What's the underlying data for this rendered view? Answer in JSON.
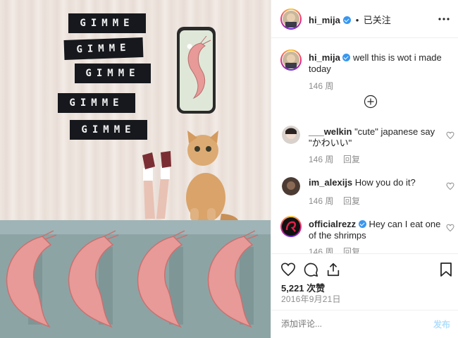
{
  "post": {
    "image_labels": [
      "GIMME",
      "GIMME",
      "GIMME",
      "GIMME",
      "GIMME"
    ],
    "image_alt_icon": "shrimp-collage-image"
  },
  "header": {
    "username": "hi_mija",
    "separator": "•",
    "follow_status": "已关注",
    "more_icon": "ellipsis-icon"
  },
  "caption": {
    "username": "hi_mija",
    "text": "well this is wot i made today",
    "time": "146 周"
  },
  "load_more_icon": "plus-circle-icon",
  "comments": [
    {
      "username": "___welkin",
      "text": "\"cute\" japanese say \"かわいい\"",
      "time": "146 周",
      "reply": "回复",
      "verified": false
    },
    {
      "username": "im_alexijs",
      "text": "How you do it?",
      "time": "146 周",
      "reply": "回复",
      "verified": false
    },
    {
      "username": "officialrezz",
      "text": "Hey can I eat one of the shrimps",
      "time": "146 周",
      "reply": "回复",
      "verified": true
    }
  ],
  "actions": {
    "likes": "5,221 次赞",
    "date": "2016年9月21日",
    "icons": [
      "heart-icon",
      "comment-icon",
      "share-icon",
      "bookmark-icon"
    ]
  },
  "add_comment": {
    "placeholder": "添加评论...",
    "post_label": "发布"
  },
  "colors": {
    "verified": "#3897f0",
    "post_button": "#b2dffc",
    "meta": "#8e8e8e",
    "wall": "#8da4a5",
    "shrimp": "#e79a98"
  }
}
